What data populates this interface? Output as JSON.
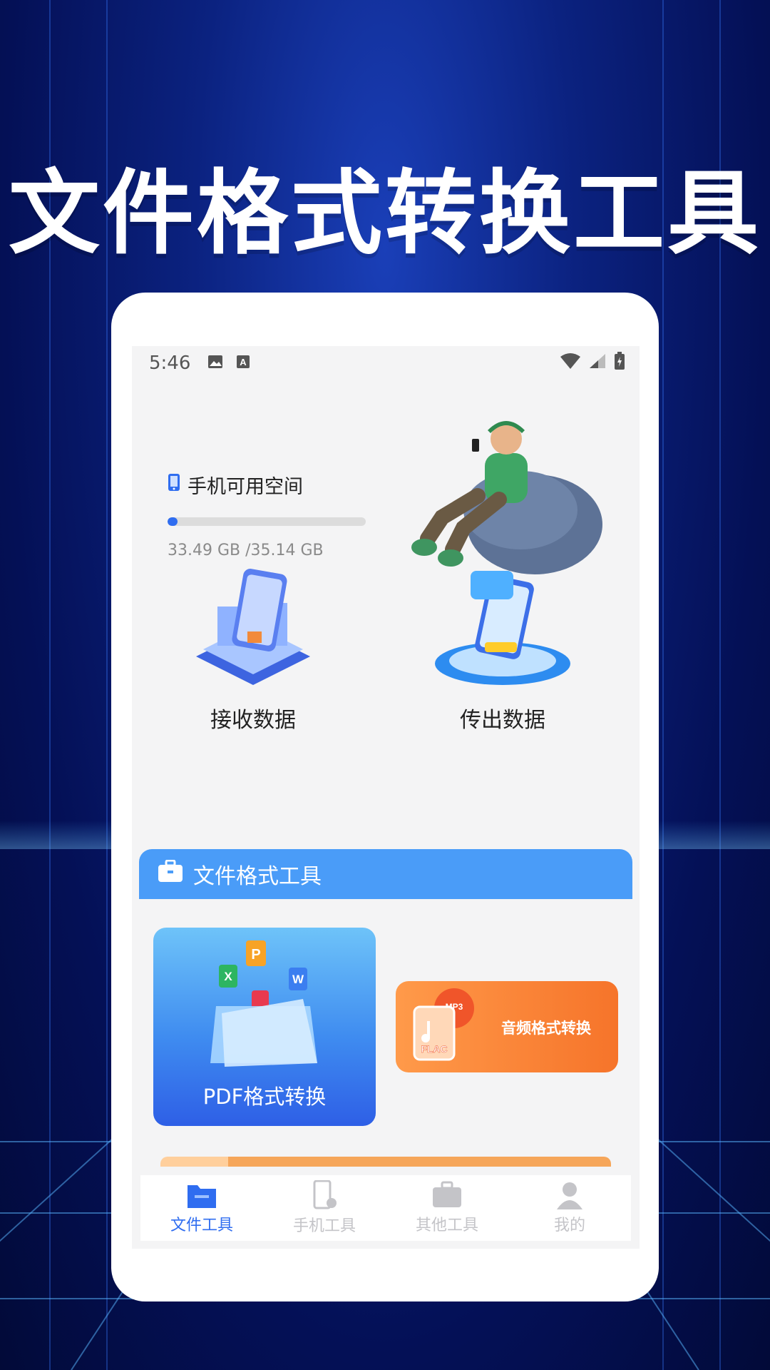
{
  "headline": "文件格式转换工具",
  "status_bar": {
    "time": "5:46"
  },
  "storage": {
    "title": "手机可用空间",
    "used_text": "33.49 GB",
    "total_text": "/35.14 GB",
    "progress_fraction": 0.05
  },
  "tiles": [
    {
      "label": "接收数据",
      "icon": "receive-data-illustration"
    },
    {
      "label": "传出数据",
      "icon": "send-data-illustration"
    }
  ],
  "section": {
    "title": "文件格式工具",
    "icon": "briefcase-icon"
  },
  "cards": {
    "pdf": {
      "label": "PDF格式转换",
      "icons": [
        "P",
        "X",
        "W"
      ]
    },
    "audio": {
      "label": "音频格式转换",
      "badges": [
        "MP3",
        "FLAC"
      ]
    }
  },
  "tabbar": [
    {
      "label": "文件工具",
      "icon": "folder-icon",
      "active": true
    },
    {
      "label": "手机工具",
      "icon": "phone-settings-icon",
      "active": false
    },
    {
      "label": "其他工具",
      "icon": "toolbox-icon",
      "active": false
    },
    {
      "label": "我的",
      "icon": "user-icon",
      "active": false
    }
  ],
  "colors": {
    "accent": "#2f6df0",
    "section": "#4a9cf8",
    "audio": "#f6742a",
    "bg": "#041056"
  }
}
